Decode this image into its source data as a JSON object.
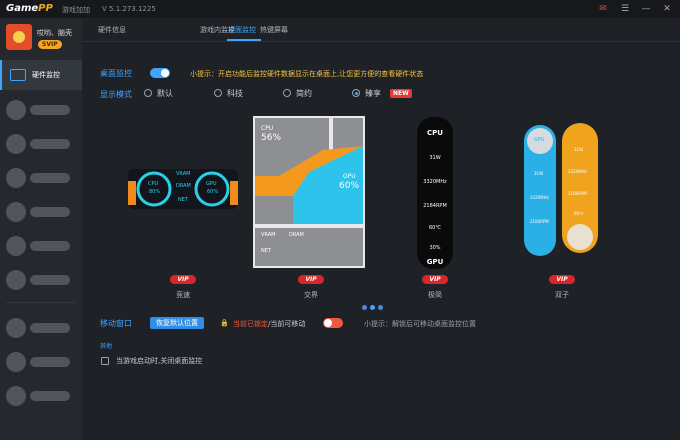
{
  "app": {
    "logo": "GamePP",
    "subtitle": "游戏加加",
    "version": "V 5.1.273.1225"
  },
  "user": {
    "name": "哎哟、脑壳",
    "badge": "SVIP"
  },
  "sidebar": {
    "active_label": "硬件监控"
  },
  "tabs": [
    "硬件信息",
    "桌面监控",
    "游戏内监控",
    "热键屏幕"
  ],
  "desktop_monitor": {
    "label": "桌面监控",
    "tip": "小提示：开启功能后监控硬件数据显示在桌面上,让您更方便的查看硬件状态"
  },
  "display_mode": {
    "label": "显示模式",
    "options": [
      "默认",
      "科技",
      "简约",
      "臻享"
    ],
    "new_badge": "NEW"
  },
  "previews": [
    {
      "name": "竞速",
      "vip": "VIP"
    },
    {
      "name": "交界",
      "vip": "VIP"
    },
    {
      "name": "极简",
      "vip": "VIP"
    },
    {
      "name": "双子",
      "vip": "VIP"
    }
  ],
  "preview_text": {
    "p1_cpu": "CPU",
    "p1_cpu_val": "80%",
    "p1_gpu": "GPU",
    "p1_gpu_val": "60%",
    "p1_vram": "VRAM",
    "p1_dram": "DRAM",
    "p1_net": "NET",
    "p2_cpu": "CPU",
    "p2_cpu_val": "56%",
    "p2_gpu": "GPU",
    "p2_gpu_val": "60%",
    "p2_vram": "VRAM",
    "p2_dram": "DRAM",
    "p2_net": "NET",
    "p3_cpu": "CPU",
    "p3_gpu": "GPU",
    "p3_v1": "31W",
    "p3_v2": "3320MHz",
    "p3_v3": "2184RPM",
    "p3_v4": "60℃",
    "p3_v5": "30%",
    "p4_gpu": "GPU",
    "p4_v1": "31W",
    "p4_v2": "3320MHz",
    "p4_v3": "2184RPM",
    "p4_v4": "60℃"
  },
  "move_window": {
    "label": "移动窗口",
    "reset_button": "恢复默认位置",
    "lock_state": "当前已锁定",
    "lock_alt": "/当前可移动",
    "tip": "小提示：解锁后可移动桌面监控位置"
  },
  "other": {
    "label": "其他",
    "checkbox_label": "当游戏启动时,关闭桌面监控"
  },
  "colors": {
    "accent": "#3ea6ff",
    "vip": "#d9262b",
    "svip": "#f5a623"
  }
}
